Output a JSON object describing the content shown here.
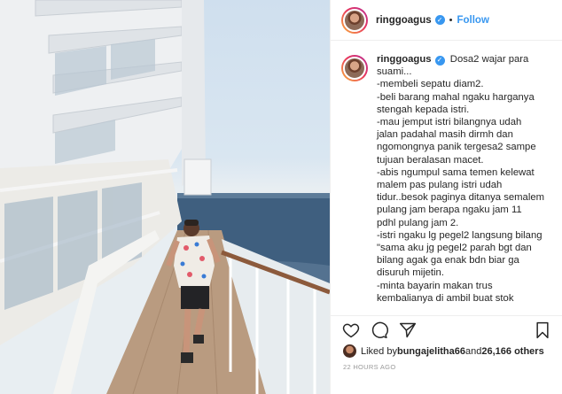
{
  "post": {
    "username": "ringgoagus",
    "follow_label": "Follow",
    "dot": "•",
    "caption_lines": [
      "Dosa2 wajar para",
      "suami...",
      "-membeli sepatu diam2.",
      "-beli barang mahal ngaku harganya",
      "stengah kepada istri.",
      "-mau jemput istri bilangnya udah",
      "jalan padahal masih dirmh dan",
      "ngomongnya panik tergesa2 sampe",
      "tujuan beralasan macet.",
      "-abis ngumpul sama temen kelewat",
      "malem pas pulang istri udah",
      "tidur..besok paginya ditanya semalem",
      "pulang jam berapa ngaku jam 11",
      "pdhl pulang jam 2.",
      "-istri ngaku lg pegel2 langsung bilang",
      "\"sama aku jg pegel2 parah bgt dan",
      "bilang agak ga enak bdn biar ga",
      "disuruh mijetin.",
      "-minta bayarin makan trus",
      "kembalianya di ambil buat stok"
    ],
    "likes_prefix": "Liked by ",
    "liked_by": "bungajelitha66",
    "likes_middle": " and ",
    "likes_count": "26,166 others",
    "timestamp": "22 HOURS AGO"
  },
  "icons": {
    "verified": "verified-badge-icon",
    "like": "heart-icon",
    "comment": "comment-icon",
    "share": "share-icon",
    "save": "bookmark-icon"
  },
  "colors": {
    "accent": "#3897f0",
    "text": "#262626",
    "muted": "#999999",
    "divider": "#efefef"
  }
}
